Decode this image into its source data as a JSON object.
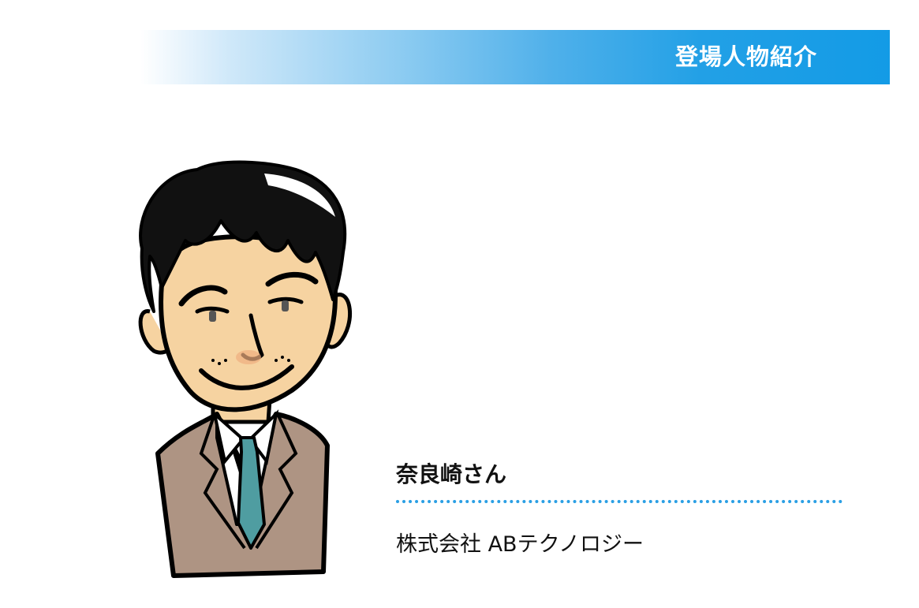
{
  "banner": {
    "title": "登場人物紹介"
  },
  "character": {
    "name": "奈良崎さん",
    "company": "株式会社 ABテクノロジー",
    "illustration": "man-in-suit-illustration"
  },
  "colors": {
    "accent": "#139be6",
    "divider": "#2a9fe4",
    "suit": "#ae9483",
    "tie": "#4f9da1",
    "skin": "#f6d3a1"
  }
}
